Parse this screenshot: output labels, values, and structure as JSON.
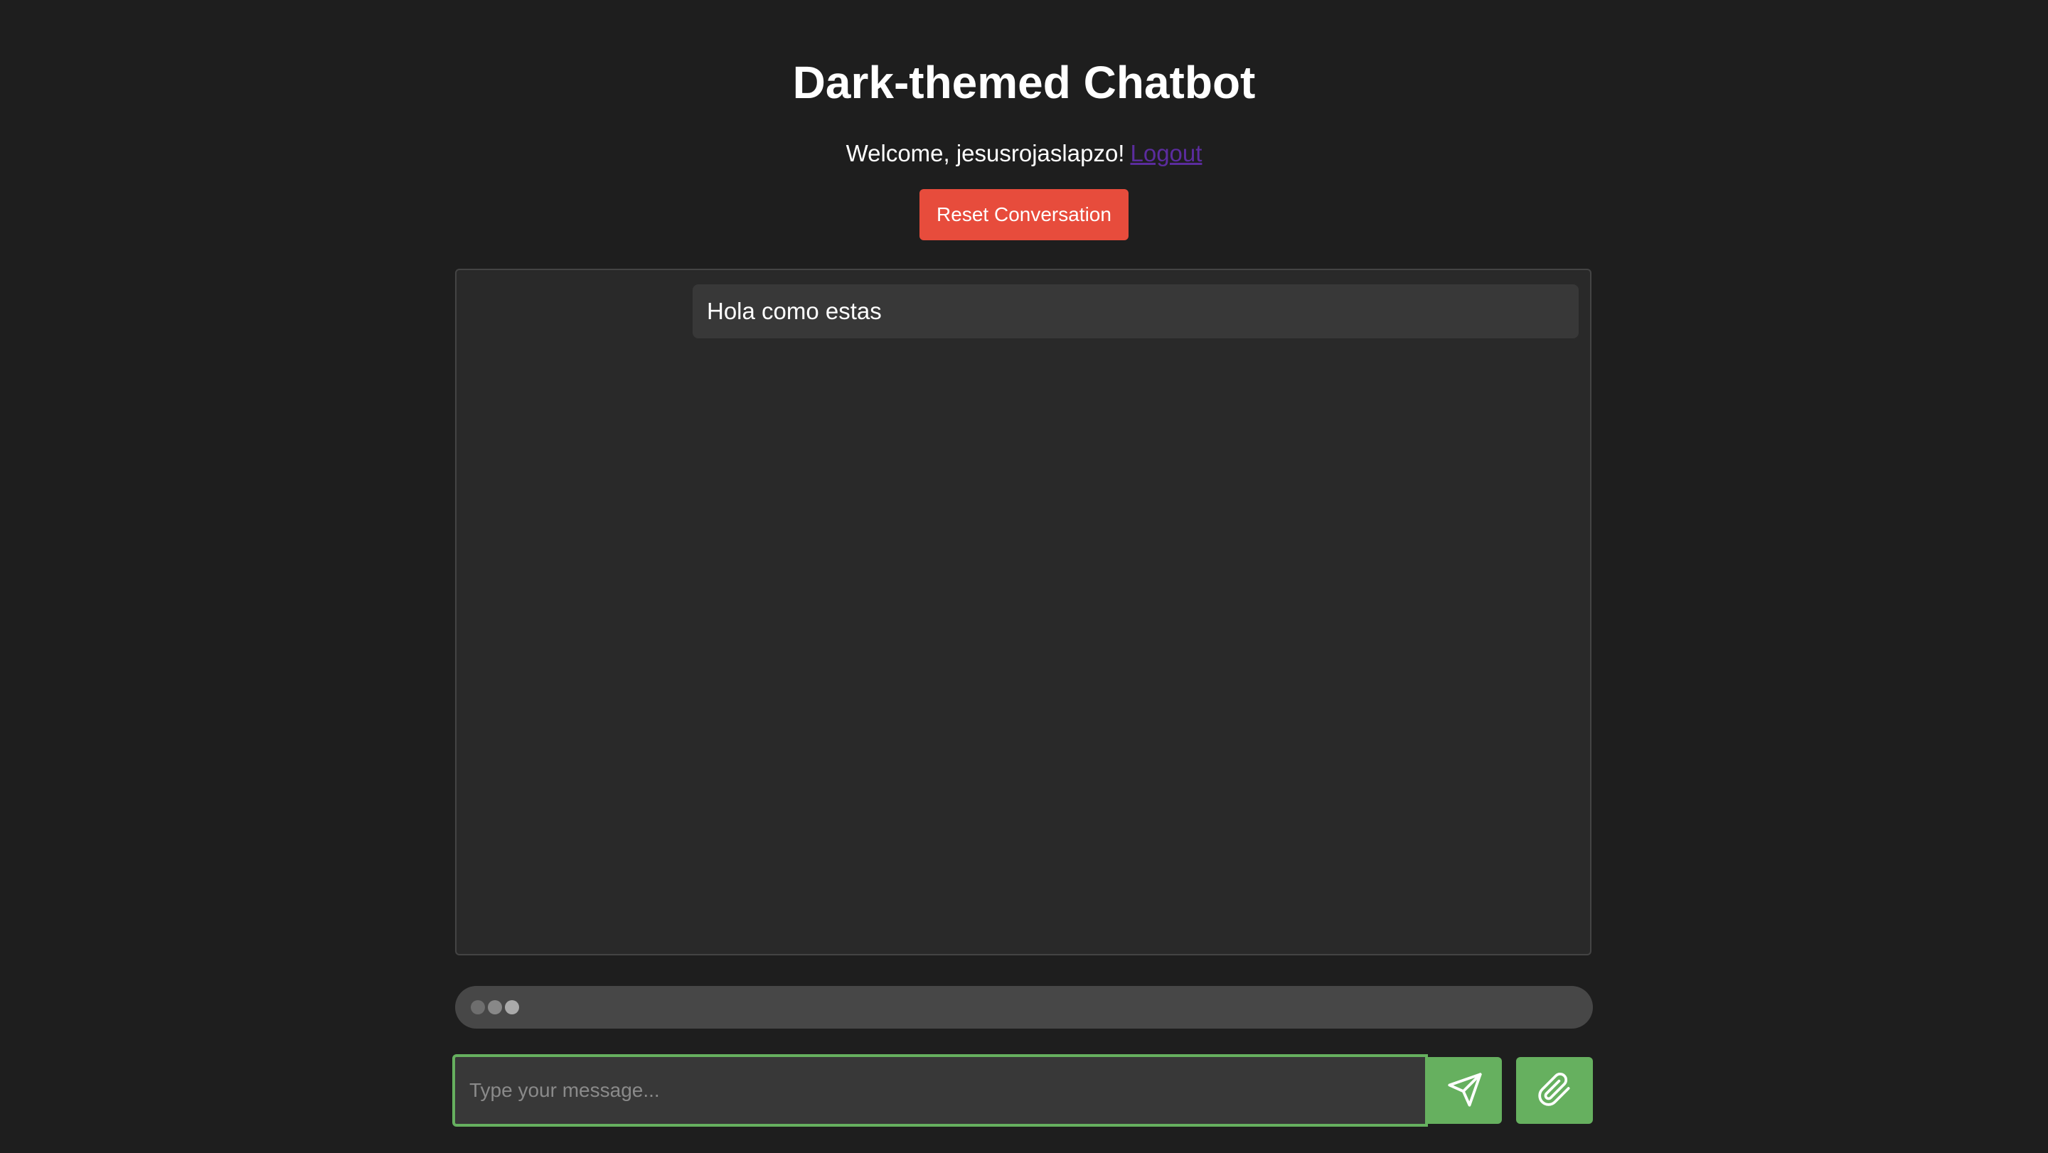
{
  "header": {
    "title": "Dark-themed Chatbot",
    "welcome_text": "Welcome, jesusrojaslapzo!",
    "logout_label": "Logout",
    "reset_label": "Reset Conversation"
  },
  "chat": {
    "messages": [
      {
        "role": "user",
        "text": "Hola como estas"
      }
    ]
  },
  "composer": {
    "placeholder": "Type your message...",
    "value": "",
    "send_icon": "send-icon",
    "attach_icon": "paperclip-icon"
  },
  "colors": {
    "background": "#1e1e1e",
    "accent_green": "#66b05f",
    "reset_red": "#e74c3c",
    "link_purple": "#5b2c9e"
  }
}
